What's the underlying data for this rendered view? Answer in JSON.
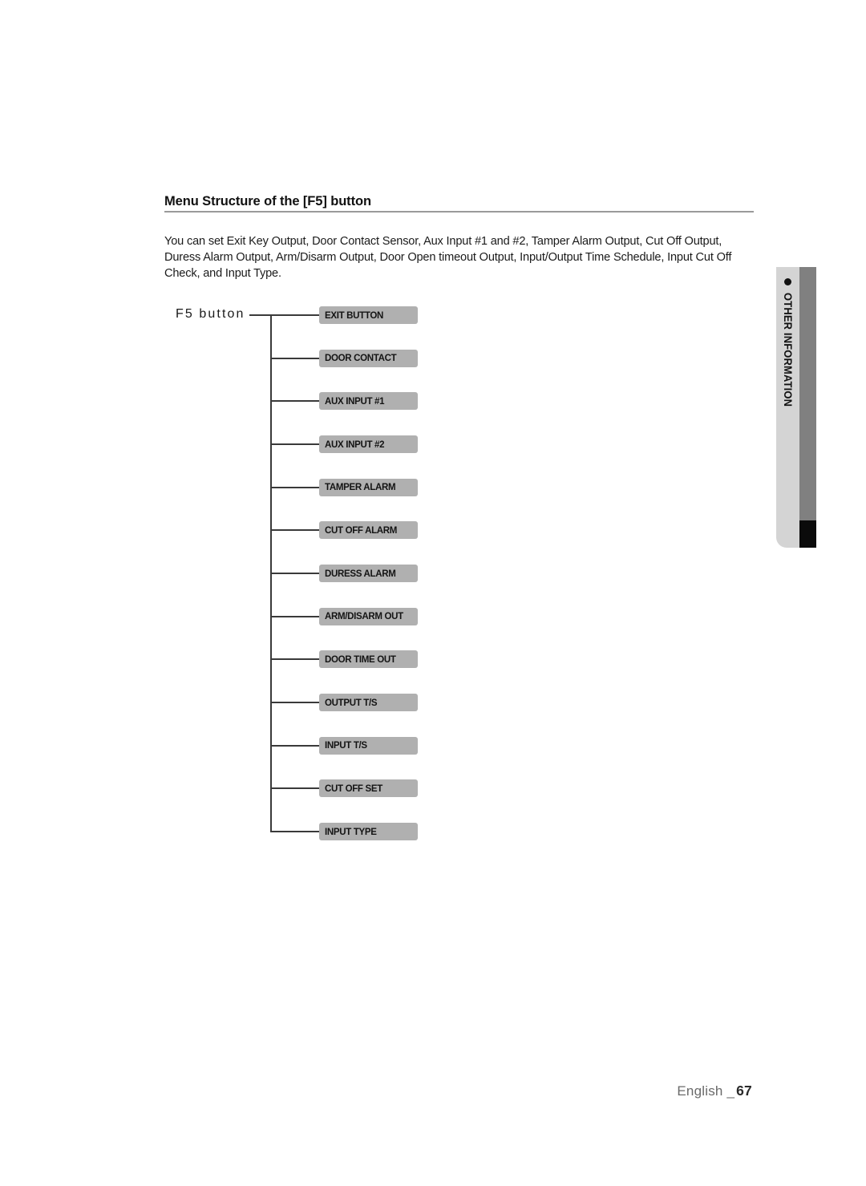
{
  "document": {
    "heading": "Menu Structure of the [F5] button",
    "body_text": "You can set Exit Key Output, Door Contact Sensor, Aux Input #1 and #2, Tamper Alarm Output, Cut Off Output, Duress Alarm Output, Arm/Disarm Output, Door Open timeout Output, Input/Output Time Schedule, Input Cut Off Check, and Input Type."
  },
  "diagram": {
    "root_label": "F5 button",
    "nodes": [
      {
        "label": "EXIT BUTTON"
      },
      {
        "label": "DOOR CONTACT"
      },
      {
        "label": "AUX INPUT #1"
      },
      {
        "label": "AUX INPUT #2"
      },
      {
        "label": "TAMPER ALARM"
      },
      {
        "label": "CUT OFF ALARM"
      },
      {
        "label": "DURESS ALARM"
      },
      {
        "label": "ARM/DISARM OUT"
      },
      {
        "label": "DOOR TIME OUT"
      },
      {
        "label": "OUTPUT T/S"
      },
      {
        "label": "INPUT T/S"
      },
      {
        "label": "CUT OFF SET"
      },
      {
        "label": "INPUT TYPE"
      }
    ]
  },
  "side_tab": {
    "title": "OTHER INFORMATION",
    "bullet": "bullet-dot-icon",
    "panel_color": "#d4d4d4",
    "stripe_color": "#808080",
    "block_color": "#0b0b0b"
  },
  "footer": {
    "language": "English _",
    "page_number": "67"
  },
  "colors": {
    "node_fill": "#b0b0b0",
    "connector": "#3a3a3a",
    "heading_rule": "#9a9a9a",
    "footer_text": "#6a6a6a"
  }
}
